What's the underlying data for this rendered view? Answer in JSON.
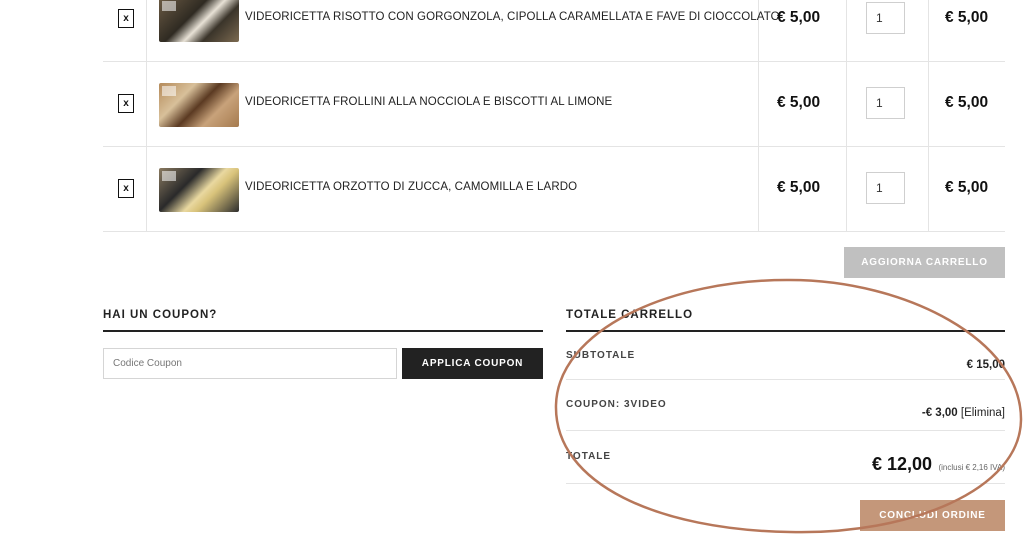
{
  "cart": {
    "items": [
      {
        "remove_label": "x",
        "image_icon": "risotto-dish-thumbnail",
        "name": "VIDEORICETTA RISOTTO CON GORGONZOLA, CIPOLLA CARAMELLATA E FAVE DI CIOCCOLATO",
        "price": "€ 5,00",
        "quantity": "1",
        "subtotal": "€ 5,00"
      },
      {
        "remove_label": "x",
        "image_icon": "cookies-thumbnail",
        "name": "VIDEORICETTA FROLLINI ALLA NOCCIOLA E BISCOTTI AL LIMONE",
        "price": "€ 5,00",
        "quantity": "1",
        "subtotal": "€ 5,00"
      },
      {
        "remove_label": "x",
        "image_icon": "orzotto-dish-thumbnail",
        "name": "VIDEORICETTA ORZOTTO DI ZUCCA, CAMOMILLA E LARDO",
        "price": "€ 5,00",
        "quantity": "1",
        "subtotal": "€ 5,00"
      }
    ],
    "update_button": "AGGIORNA CARRELLO"
  },
  "coupon": {
    "title": "HAI UN COUPON?",
    "placeholder": "Codice Coupon",
    "apply_button": "APPLICA COUPON"
  },
  "totals": {
    "title": "TOTALE CARRELLO",
    "subtotal_label": "SUBTOTALE",
    "subtotal_value": "€ 15,00",
    "coupon_label": "COUPON: 3VIDEO",
    "coupon_value": "-€ 3,00",
    "coupon_remove": "[Elimina]",
    "total_label": "TOTALE",
    "total_value": "€ 12,00",
    "total_tax_note": "(inclusi € 2,16 IVA)",
    "checkout_button": "CONCLUDI ORDINE"
  },
  "colors": {
    "accent": "#c4977a",
    "annotation_ellipse": "#b7775a",
    "dark_button": "#222222",
    "disabled_button": "#c0c0c0"
  }
}
